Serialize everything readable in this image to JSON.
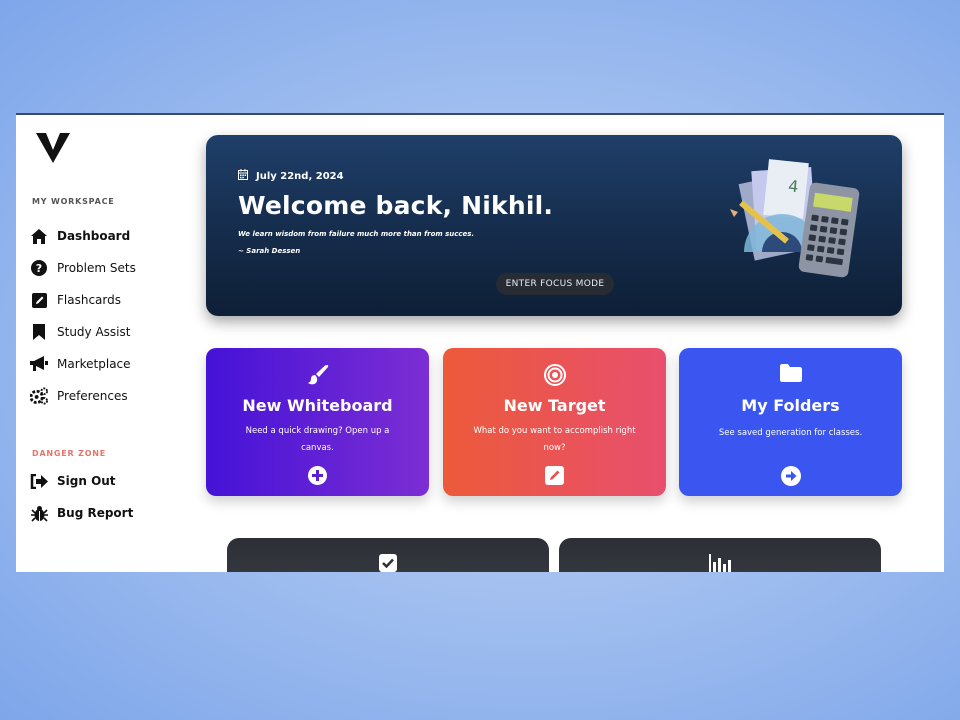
{
  "sidebar": {
    "sections": [
      {
        "label": "MY WORKSPACE"
      },
      {
        "label": "DANGER ZONE"
      }
    ],
    "items": [
      {
        "label": "Dashboard",
        "icon": "home-icon"
      },
      {
        "label": "Problem Sets",
        "icon": "question-circle-icon"
      },
      {
        "label": "Flashcards",
        "icon": "edit-square-icon"
      },
      {
        "label": "Study Assist",
        "icon": "bookmark-icon"
      },
      {
        "label": "Marketplace",
        "icon": "megaphone-icon"
      },
      {
        "label": "Preferences",
        "icon": "gears-icon"
      },
      {
        "label": "Sign Out",
        "icon": "sign-out-icon"
      },
      {
        "label": "Bug Report",
        "icon": "bug-icon"
      }
    ]
  },
  "hero": {
    "date": "July 22nd, 2024",
    "welcome": "Welcome back, Nikhil.",
    "quote": "We learn wisdom from failure much more than from succes.",
    "author": "~ Sarah Dessen",
    "focus_button": "ENTER FOCUS MODE"
  },
  "cards": [
    {
      "title": "New Whiteboard",
      "desc": "Need a quick drawing? Open up a canvas.",
      "top_icon": "paintbrush-icon",
      "bottom_icon": "plus-circle-icon"
    },
    {
      "title": "New Target",
      "desc": "What do you want to accomplish right now?",
      "top_icon": "target-icon",
      "bottom_icon": "edit-icon"
    },
    {
      "title": "My Folders",
      "desc": "See saved generation for classes.",
      "top_icon": "folder-icon",
      "bottom_icon": "arrow-right-circle-icon"
    }
  ],
  "bottom_cards": [
    {
      "icon": "checkbox-icon"
    },
    {
      "icon": "bar-chart-icon"
    }
  ],
  "colors": {
    "whiteboard_start": "#4512d7",
    "whiteboard_end": "#7c2ed3",
    "target_start": "#ec5a3a",
    "target_end": "#e84f6e",
    "folders": "#3a55f0",
    "hero_dark": "#142a48",
    "danger": "#e8736b"
  }
}
